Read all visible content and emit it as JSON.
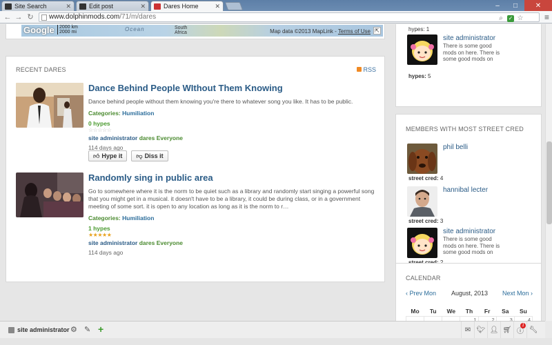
{
  "browser": {
    "tabs": [
      {
        "label": "Site Search",
        "icon": "site-favicon"
      },
      {
        "label": "Edit post",
        "icon": "site-favicon"
      },
      {
        "label": "Dares Home",
        "icon": "dares-favicon",
        "active": true
      }
    ],
    "url_host": "www.dolphinmods.com",
    "url_path": "/71/m/dares"
  },
  "map": {
    "logo": "Google",
    "scale_km": "2000 km",
    "scale_mi": "2000 mi",
    "ocean_label": "Ocean",
    "region_label_1": "South",
    "region_label_2": "Africa",
    "credit": "Map data ©2013 MapLink - ",
    "terms": "Terms of Use"
  },
  "dares": {
    "heading": "RECENT DARES",
    "rss": "RSS",
    "items": [
      {
        "title": "Dance Behind People WIthout Them Knowing",
        "desc": "Dance behind people without them knowing you're there to whatever song you like. It has to be public.",
        "categories_label": "Categories:",
        "category": "Humiliation",
        "hypes": "0 hypes",
        "rating": 0,
        "author": "site administrator",
        "verb": "dares",
        "target": "Everyone",
        "time": "114 days ago",
        "hype_btn": "Hype it",
        "diss_btn": "Diss it"
      },
      {
        "title": "Randomly sing in public area",
        "desc": "Go to somewhere where it is the norm to be quiet such as a library and randomly start singing a powerful song that you might get in a musical. it doesn't have to be a library, it could be during class, or in a government meeting of some sort. it is open to any location as long as it is the norm to r…",
        "categories_label": "Categories:",
        "category": "Humiliation",
        "hypes": "1 hypes",
        "rating": 5,
        "author": "site administrator",
        "verb": "dares",
        "target": "Everyone",
        "time": "114 days ago"
      }
    ]
  },
  "top_hyped": {
    "partial_stat": "hypes: 1",
    "member": {
      "name": "site administrator",
      "desc": "There is some good mods on here. There is some good mods on",
      "stat_label": "hypes:",
      "stat_value": "5"
    }
  },
  "street_cred": {
    "heading": "MEMBERS WITH MOST STREET CRED",
    "members": [
      {
        "name": "phil belli",
        "stat_label": "street cred:",
        "stat_value": "4"
      },
      {
        "name": "hannibal lecter",
        "stat_label": "street cred:",
        "stat_value": "3"
      },
      {
        "name": "site administrator",
        "desc": "There is some good mods on here. There is some good mods on",
        "stat_label": "street cred:",
        "stat_value": "2"
      }
    ]
  },
  "calendar": {
    "heading": "CALENDAR",
    "prev": "‹ Prev Mon",
    "month": "August, 2013",
    "next": "Next Mon ›",
    "days": [
      "Mo",
      "Tu",
      "We",
      "Th",
      "Fr",
      "Sa",
      "Su"
    ],
    "first_week": [
      "",
      "",
      "",
      "1",
      "2",
      "3",
      "4"
    ]
  },
  "bottombar": {
    "user": "site administrator",
    "notification_count": "1"
  },
  "colors": {
    "link": "#2a5b86",
    "category": "#4a8a2f",
    "star": "#e8a21c"
  }
}
